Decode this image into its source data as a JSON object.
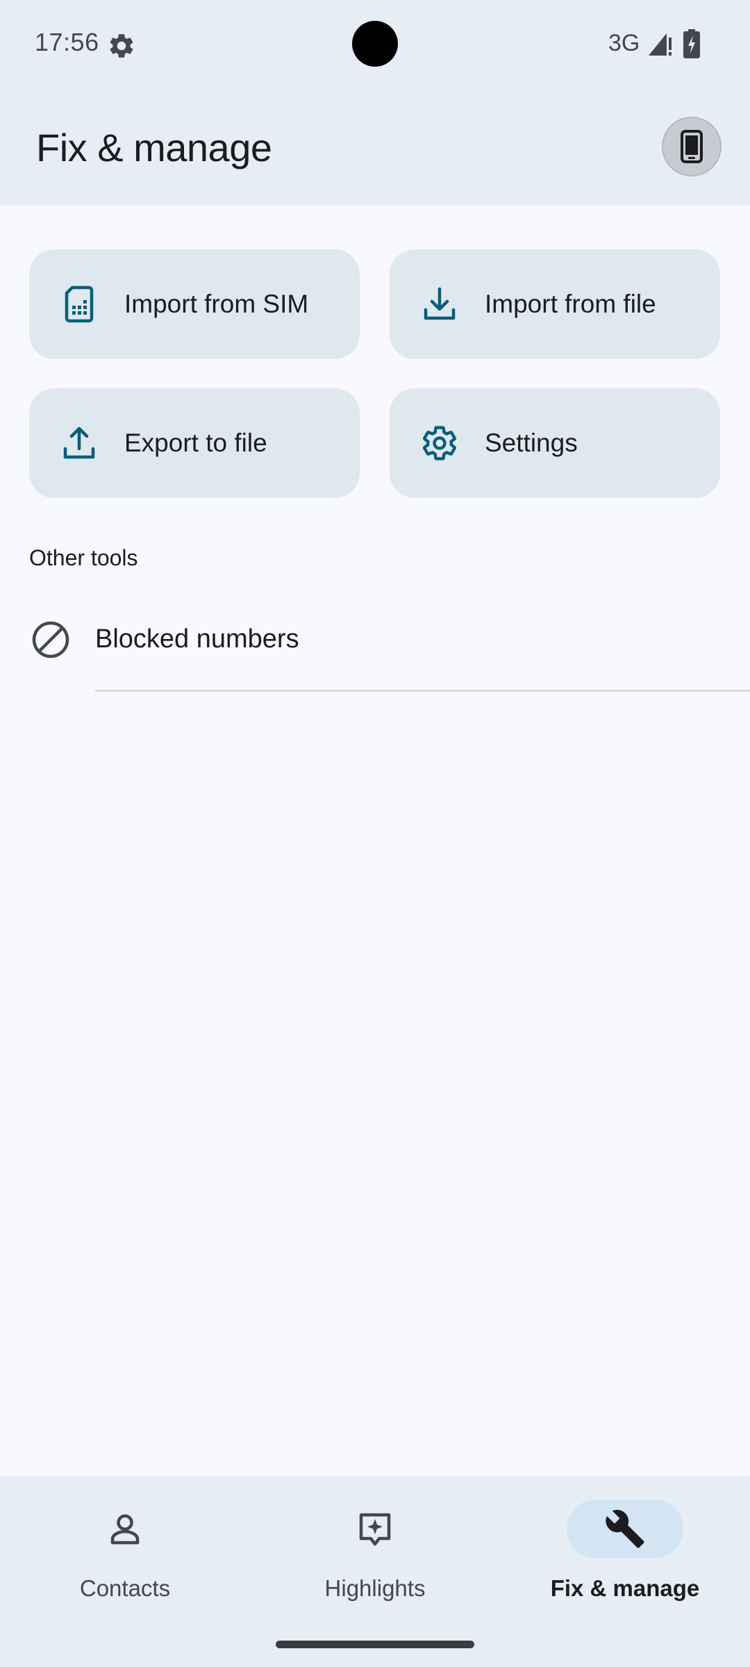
{
  "status_bar": {
    "time": "17:56",
    "network": "3G",
    "settings_icon": "gear-icon",
    "signal_icon": "signal-icon",
    "battery_icon": "battery-charging-icon"
  },
  "header": {
    "title": "Fix & manage",
    "device_icon": "phone-device-icon"
  },
  "tiles": [
    {
      "label": "Import from SIM",
      "icon": "sim-card-icon"
    },
    {
      "label": "Import from file",
      "icon": "download-icon"
    },
    {
      "label": "Export to file",
      "icon": "upload-icon"
    },
    {
      "label": "Settings",
      "icon": "gear-icon"
    }
  ],
  "other_tools": {
    "header": "Other tools",
    "items": [
      {
        "label": "Blocked numbers",
        "icon": "block-icon"
      }
    ]
  },
  "bottom_nav": {
    "items": [
      {
        "label": "Contacts",
        "icon": "person-icon",
        "active": false
      },
      {
        "label": "Highlights",
        "icon": "highlights-icon",
        "active": false
      },
      {
        "label": "Fix & manage",
        "icon": "wrench-icon",
        "active": true
      }
    ]
  },
  "colors": {
    "accent": "#0b5d78",
    "surface": "#e6edf4",
    "tile": "#dfe8ee",
    "background": "#f8f9fd",
    "active_indicator": "#d3e4f2"
  }
}
